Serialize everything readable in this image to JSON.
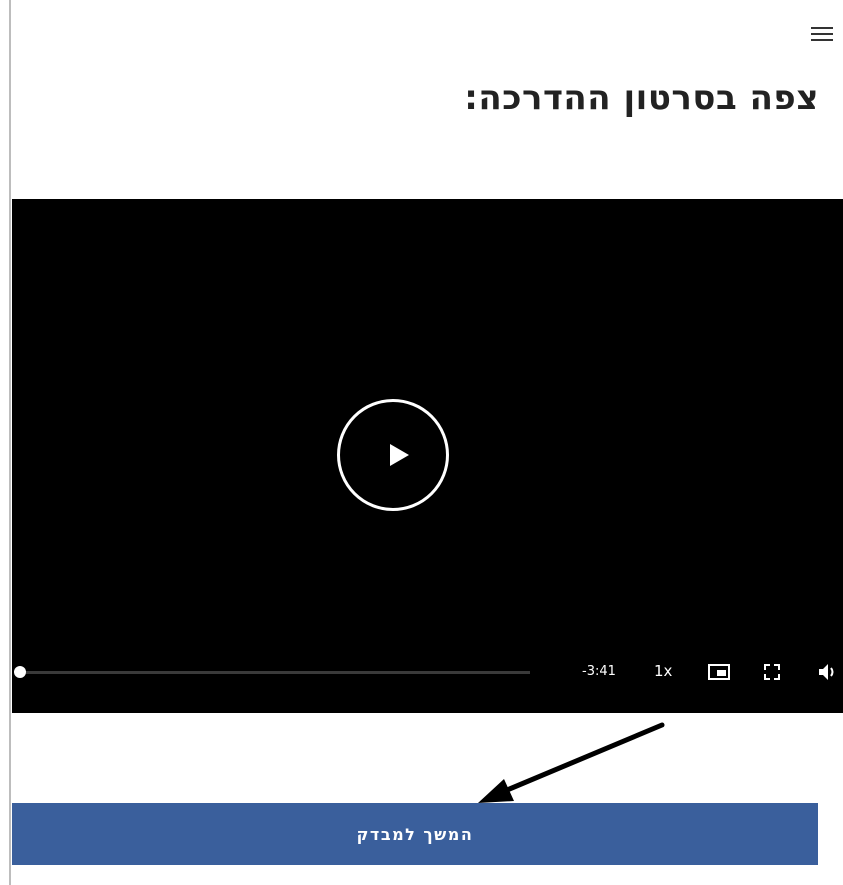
{
  "header": {
    "title": "צפה בסרטון ההדרכה:",
    "menu_icon": "hamburger-icon"
  },
  "video_player": {
    "play_icon": "play-icon",
    "progress": 0,
    "time_remaining": "-3:41",
    "speed_label": "1x",
    "pip_icon": "picture-in-picture-icon",
    "fullscreen_icon": "fullscreen-icon",
    "volume_icon": "volume-icon"
  },
  "annotation": {
    "arrow_icon": "arrow-icon"
  },
  "actions": {
    "continue_label": "המשך למבדק"
  },
  "colors": {
    "video_background": "#000000",
    "button_background": "#3a5f9c",
    "button_text": "#ffffff"
  }
}
